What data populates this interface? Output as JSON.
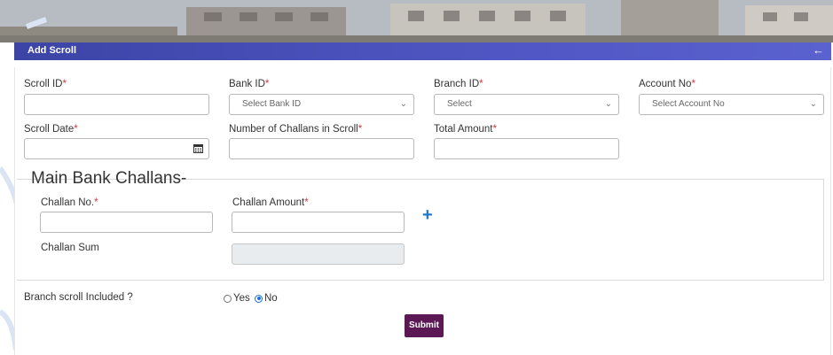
{
  "header": {
    "title": "Add Scroll",
    "back_icon": "←"
  },
  "form": {
    "scroll_id": {
      "label": "Scroll ID",
      "value": ""
    },
    "bank_id": {
      "label": "Bank ID",
      "placeholder": "Select Bank ID"
    },
    "branch_id": {
      "label": "Branch ID",
      "placeholder": "Select"
    },
    "account_no": {
      "label": "Account No",
      "placeholder": "Select Account No"
    },
    "scroll_date": {
      "label": "Scroll Date",
      "value": ""
    },
    "num_challans": {
      "label": "Number of Challans in Scroll",
      "value": ""
    },
    "total_amount": {
      "label": "Total Amount",
      "value": ""
    },
    "required_mark": "*"
  },
  "challans": {
    "title": "Main Bank Challans-",
    "challan_no": {
      "label": "Challan No.",
      "value": ""
    },
    "challan_amount": {
      "label": "Challan Amount",
      "value": ""
    },
    "challan_sum": {
      "label": "Challan Sum",
      "value": ""
    },
    "add_icon": "+"
  },
  "branch_scroll": {
    "label": "Branch scroll Included ?",
    "options": [
      "Yes",
      "No"
    ],
    "selected": "No"
  },
  "submit_label": "Submit",
  "colors": {
    "header": "#4a51bd",
    "submit": "#5c1854",
    "required": "#d9323c",
    "link": "#1f78c8"
  }
}
